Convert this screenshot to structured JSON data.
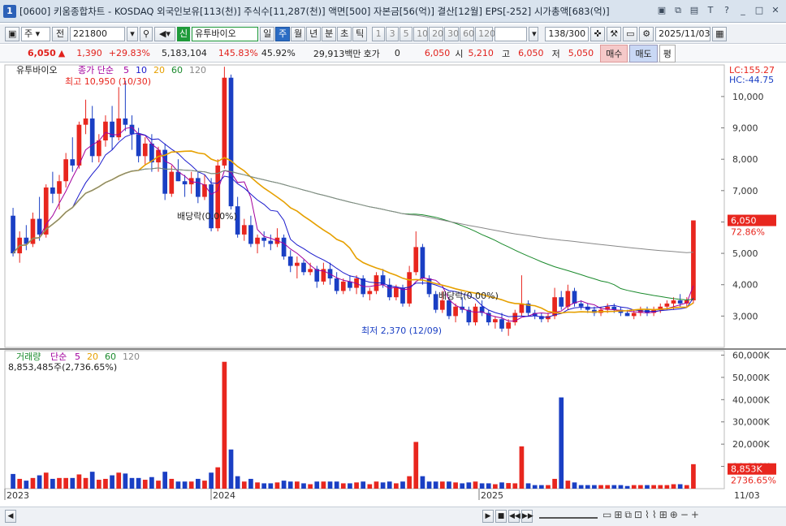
{
  "title": "[0600] 키움종합차트 - KOSDAQ 외국인보유[113(천)] 주식수[11,287(천)] 액면[500] 자본금[56(억)] 결산[12월] EPS[-252] 시가총액[683(억)]",
  "window_num": "1",
  "toolbar": {
    "market": "주",
    "all": "전",
    "code": "221800",
    "name": "유투바이오",
    "new_badge": "신",
    "periods": [
      "일",
      "주",
      "월",
      "년",
      "분",
      "초",
      "틱"
    ],
    "active_period": "주",
    "nums": [
      "1",
      "3",
      "5",
      "10",
      "20",
      "30",
      "60",
      "120"
    ],
    "count": "138/300",
    "date": "2025/11/03"
  },
  "quote": {
    "price": "6,050",
    "change": "1,390",
    "change_pct": "+29.83%",
    "volume": "5,183,104",
    "vol_ratio": "145.83%",
    "turnover": "45.92%",
    "amount": "29,913백만",
    "hoga_label": "호가",
    "hoga_val": "0",
    "hoga_price": "6,050",
    "open_label": "시",
    "open": "5,210",
    "high_label": "고",
    "high": "6,050",
    "low_label": "저",
    "low": "5,050",
    "buy": "매수",
    "sell": "매도",
    "eval": "평"
  },
  "chart_data": {
    "type": "candlestick",
    "price_legend": {
      "name": "유투바이오",
      "ma_label": "종가 단순",
      "periods": [
        "5",
        "10",
        "20",
        "60",
        "120"
      ],
      "colors": [
        "#a2009e",
        "#1a1acc",
        "#e6a000",
        "#1a8a2c",
        "#888888"
      ]
    },
    "price_axis": [
      "10,000",
      "9,000",
      "8,000",
      "7,000",
      "6,000",
      "5,000",
      "4,000",
      "3,000"
    ],
    "price_range": [
      2000,
      10800
    ],
    "lc": "LC:155.27",
    "hc": "HC:-44.75",
    "current_price": "6,050",
    "current_pct": "72.86%",
    "annotations": {
      "max": "최고 10,950 (10/30)",
      "min": "최저 2,370 (12/09)",
      "div1": "배당락(0.00%)",
      "div2": "배당락(0.00%)"
    },
    "volume_legend": {
      "name": "거래량",
      "ma_label": "단순",
      "periods": [
        "5",
        "20",
        "60",
        "120"
      ],
      "colors": [
        "#a2009e",
        "#e6a000",
        "#1a8a2c",
        "#888888"
      ],
      "readout": "8,853,485주(2,736.65%)"
    },
    "volume_axis": [
      "60,000K",
      "50,000K",
      "40,000K",
      "30,000K",
      "20,000K",
      "10,000K"
    ],
    "volume_range_k": [
      0,
      62000
    ],
    "current_volume": "8,853K",
    "current_volume_pct": "2736.65%",
    "x_labels": [
      "2023",
      "2024",
      "2025"
    ],
    "x_last": "11/03",
    "candles": [
      [
        6200,
        6450,
        4900,
        5000
      ],
      [
        5000,
        5700,
        4700,
        5500
      ],
      [
        5500,
        5900,
        5100,
        5300
      ],
      [
        5300,
        6300,
        5200,
        6100
      ],
      [
        6100,
        6800,
        5400,
        5600
      ],
      [
        5600,
        7200,
        5500,
        7100
      ],
      [
        7100,
        7600,
        6600,
        6900
      ],
      [
        6900,
        7500,
        6400,
        7300
      ],
      [
        7300,
        8200,
        7100,
        8000
      ],
      [
        8000,
        8700,
        7600,
        7800
      ],
      [
        7800,
        9200,
        7700,
        9100
      ],
      [
        9100,
        9900,
        8800,
        9300
      ],
      [
        9300,
        9700,
        7900,
        8100
      ],
      [
        8100,
        8800,
        7900,
        8600
      ],
      [
        8600,
        9400,
        8400,
        9200
      ],
      [
        9200,
        9700,
        8300,
        8700
      ],
      [
        8700,
        10300,
        8600,
        9300
      ],
      [
        9300,
        10500,
        8900,
        9100
      ],
      [
        9100,
        9400,
        8300,
        8800
      ],
      [
        8800,
        9000,
        7900,
        8100
      ],
      [
        8100,
        8700,
        7800,
        8500
      ],
      [
        8500,
        8800,
        7600,
        7900
      ],
      [
        7900,
        8400,
        7600,
        8300
      ],
      [
        8300,
        8500,
        6700,
        6900
      ],
      [
        6900,
        7800,
        6800,
        7600
      ],
      [
        7600,
        8000,
        7300,
        7300
      ],
      [
        7300,
        7500,
        6800,
        7200
      ],
      [
        7200,
        7600,
        6900,
        7400
      ],
      [
        7400,
        7600,
        6600,
        6800
      ],
      [
        6800,
        7500,
        6700,
        7200
      ],
      [
        7200,
        7400,
        5700,
        5800
      ],
      [
        5800,
        8000,
        5700,
        7800
      ],
      [
        7800,
        10950,
        7700,
        10600
      ],
      [
        10600,
        10700,
        6400,
        6500
      ],
      [
        6500,
        6800,
        5500,
        5600
      ],
      [
        5600,
        6100,
        5400,
        5900
      ],
      [
        5900,
        6200,
        5200,
        5300
      ],
      [
        5300,
        5600,
        5000,
        5500
      ],
      [
        5500,
        5700,
        5200,
        5400
      ],
      [
        5400,
        5600,
        5100,
        5300
      ],
      [
        5300,
        5800,
        5200,
        5500
      ],
      [
        5500,
        5600,
        4800,
        4900
      ],
      [
        4900,
        5100,
        4400,
        4600
      ],
      [
        4600,
        4900,
        4200,
        4700
      ],
      [
        4700,
        4800,
        4300,
        4400
      ],
      [
        4400,
        4700,
        4300,
        4500
      ],
      [
        4500,
        4600,
        3900,
        4100
      ],
      [
        4100,
        4700,
        4000,
        4500
      ],
      [
        4500,
        4700,
        4000,
        4200
      ],
      [
        4200,
        4400,
        3700,
        3800
      ],
      [
        3800,
        4200,
        3700,
        4100
      ],
      [
        4100,
        4300,
        3800,
        3900
      ],
      [
        3900,
        4300,
        3700,
        4200
      ],
      [
        4200,
        4300,
        3600,
        3700
      ],
      [
        3700,
        3900,
        3500,
        3800
      ],
      [
        3800,
        4400,
        3700,
        4300
      ],
      [
        4300,
        4500,
        3900,
        4000
      ],
      [
        4000,
        4200,
        3500,
        3600
      ],
      [
        3600,
        4000,
        3500,
        3900
      ],
      [
        3900,
        4000,
        3300,
        3400
      ],
      [
        3400,
        4600,
        3300,
        4400
      ],
      [
        4400,
        5700,
        4300,
        5200
      ],
      [
        5200,
        5300,
        4000,
        4200
      ],
      [
        4200,
        4300,
        3600,
        3700
      ],
      [
        3700,
        3800,
        3100,
        3200
      ],
      [
        3200,
        3800,
        3100,
        3500
      ],
      [
        3500,
        3600,
        2900,
        3000
      ],
      [
        3000,
        3400,
        2800,
        3300
      ],
      [
        3300,
        3600,
        3100,
        3200
      ],
      [
        3200,
        3300,
        2700,
        2800
      ],
      [
        2800,
        3400,
        2700,
        3300
      ],
      [
        3300,
        3500,
        3000,
        3100
      ],
      [
        3100,
        3200,
        2700,
        2800
      ],
      [
        2800,
        3000,
        2600,
        2900
      ],
      [
        2900,
        3100,
        2500,
        2600
      ],
      [
        2600,
        2900,
        2370,
        2800
      ],
      [
        2800,
        3200,
        2700,
        3100
      ],
      [
        3100,
        4300,
        3000,
        3400
      ],
      [
        3400,
        3500,
        3000,
        3100
      ],
      [
        3100,
        3200,
        2900,
        3000
      ],
      [
        3000,
        3100,
        2800,
        2900
      ],
      [
        2900,
        3100,
        2800,
        3000
      ],
      [
        3000,
        3900,
        2900,
        3600
      ],
      [
        3600,
        3800,
        3200,
        3300
      ],
      [
        3300,
        4000,
        3200,
        3800
      ],
      [
        3800,
        3900,
        3300,
        3400
      ],
      [
        3400,
        3500,
        3200,
        3300
      ],
      [
        3300,
        3400,
        3100,
        3200
      ],
      [
        3200,
        3300,
        3000,
        3100
      ],
      [
        3100,
        3300,
        3000,
        3200
      ],
      [
        3200,
        3400,
        3100,
        3300
      ],
      [
        3300,
        3400,
        3100,
        3200
      ],
      [
        3200,
        3300,
        3000,
        3100
      ],
      [
        3100,
        3200,
        3000,
        3000
      ],
      [
        3000,
        3200,
        2900,
        3100
      ],
      [
        3100,
        3300,
        3000,
        3200
      ],
      [
        3200,
        3300,
        3000,
        3100
      ],
      [
        3100,
        3300,
        3000,
        3200
      ],
      [
        3200,
        3400,
        3100,
        3300
      ],
      [
        3300,
        3500,
        3200,
        3400
      ],
      [
        3400,
        3600,
        3200,
        3500
      ],
      [
        3500,
        3700,
        3300,
        3400
      ],
      [
        3400,
        3600,
        3300,
        3500
      ],
      [
        3500,
        6050,
        3400,
        6050
      ]
    ]
  },
  "status": {
    "nav": [
      "▶",
      "■",
      "◀◀",
      "▶▶"
    ]
  }
}
